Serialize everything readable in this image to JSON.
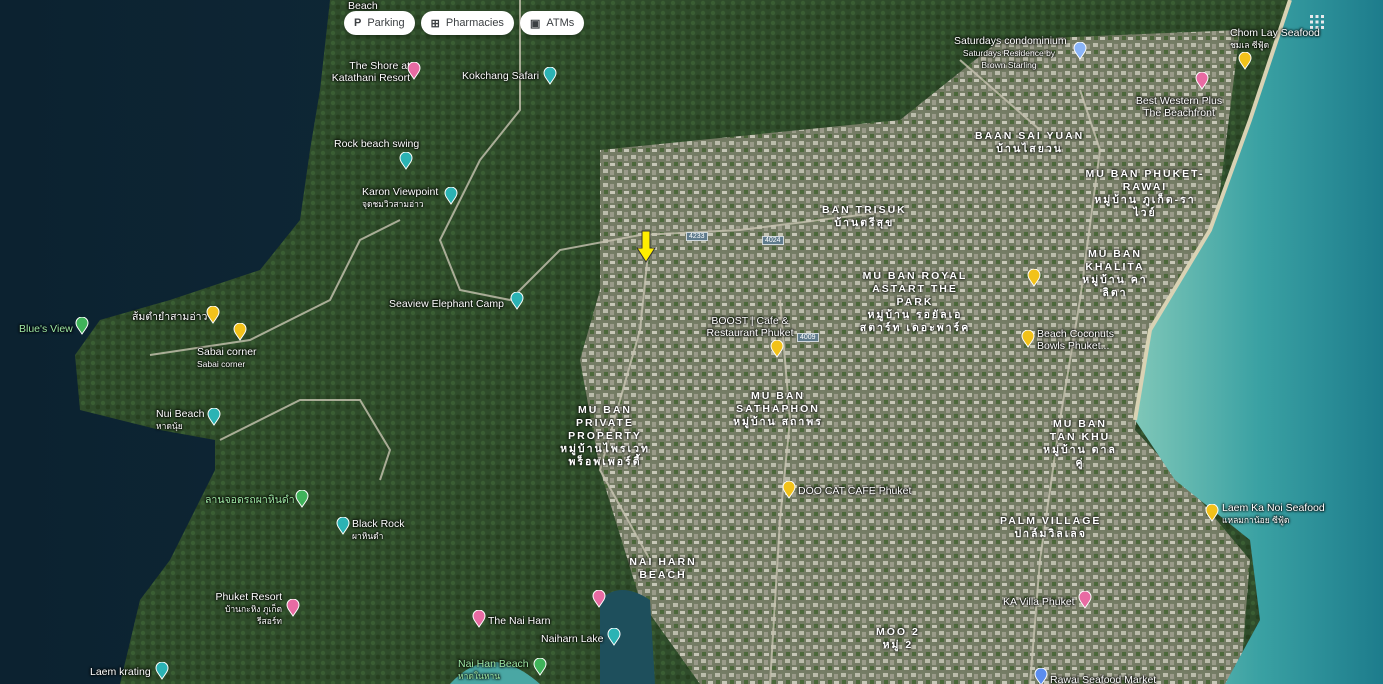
{
  "filters": [
    {
      "label": "Parking",
      "icon": "parking-icon"
    },
    {
      "label": "Pharmacies",
      "icon": "pharmacy-icon"
    },
    {
      "label": "ATMs",
      "icon": "atm-icon"
    }
  ],
  "pois": {
    "beach_top": "Beach",
    "shore": "The Shore at Katathani Resort",
    "kokchang": "Kokchang Safari",
    "rock_swing": "Rock beach swing",
    "karon_view": "Karon Viewpoint",
    "karon_view_th": "จุดชมวิวสามอ่าว",
    "seaview": "Seaview Elephant Camp",
    "somtam": "ส้มตำยำสามอ่าว",
    "blues": "Blue's View",
    "sabai": "Sabai corner",
    "sabai_sub": "Sabai corner",
    "nui": "Nui Beach",
    "nui_th": "หาดนุ้ย",
    "lan": "ลานจอดรถผาหินดำ",
    "black_rock": "Black Rock",
    "black_rock_th": "ผาหินดำ",
    "phuket_resort": "Phuket Resort",
    "phuket_resort_th": "บ้านกะหิง ภูเก็ตรีสอร์ท",
    "nai_harn": "The Nai Harn",
    "naiharn_lake": "Naiharn Lake",
    "nai_han_beach": "Nai Han Beach",
    "nai_han_beach_th": "หาดในหาน",
    "laem_krating": "Laem krating",
    "saturdays": "Saturdays condominium",
    "saturdays_sub": "Saturdays Residence by Brown Starling",
    "chom_lay": "Chom Lay Seafood",
    "chom_lay_th": "ชมเล ซีฟู้ด",
    "best_western": "Best Western Plus The Beachfront",
    "boost": "BOOST | Cafe & Restaurant Phuket",
    "beach_coconuts": "Beach Coconuts Bowls Phuket...",
    "doo_cat": "DOO CAT CAFE Phuket",
    "laem_ka_noi": "Laem Ka Noi Seafood",
    "laem_ka_noi_th": "แหลมกาน้อย ซีฟู้ด",
    "ka_villa": "KA Villa Phuket",
    "rawai_seafood": "Rawai Seafood Market"
  },
  "areas": {
    "baan_sai_yuan": "BAAN SAI YUAN",
    "baan_sai_yuan_th": "บ้านไสยวน",
    "mu_ban_phuket_rawai": "MU BAN PHUKET-RAWAI",
    "mu_ban_phuket_rawai_th": "หมู่บ้าน ภูเก็ต-ราไวย์",
    "ban_trisuk": "BAN TRISUK",
    "ban_trisuk_th": "บ้านตรีสุข",
    "mu_ban_khalita": "MU BAN KHALITA",
    "mu_ban_khalita_th": "หมู่บ้าน คาลิตา",
    "royal_astart": "MU BAN ROYAL ASTART THE PARK",
    "royal_astart_th": "หมู่บ้าน รอยัลเอ สตาร์ท เดอะพาร์ค",
    "sathaphon": "MU BAN SATHAPHON",
    "sathaphon_th": "หมู่บ้าน สถาพร",
    "private_property": "MU BAN PRIVATE PROPERTY",
    "private_property_th": "หมู่บ้านไพรเวท พร็อพเพอร์ตี้",
    "tan_khu": "MU BAN TAN KHU",
    "tan_khu_th": "หมู่บ้าน ตาลคู่",
    "palm_village": "PALM VILLAGE",
    "palm_village_th": "ปาล์มวิลเลจ",
    "nai_harn_beach": "NAI HARN BEACH",
    "moo2": "MOO 2",
    "moo2_th": "หมู่ 2"
  },
  "shields": {
    "r4009": "4009",
    "r4233": "4233",
    "r4024": "4024"
  },
  "colors": {
    "water_deep": "#0e2a3a",
    "water_shallow": "#5fb7b0",
    "forest": "#2e4a2a",
    "urban": "#9a9a86",
    "pin_yellow": "#f2c21a",
    "pin_teal": "#2bb3b4",
    "pin_pink": "#e86ba3",
    "arrow": "#ffee00"
  }
}
